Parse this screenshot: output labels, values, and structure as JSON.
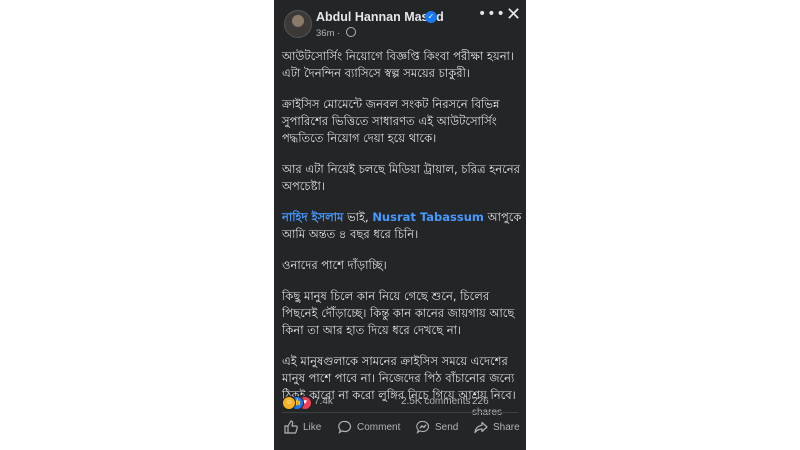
{
  "post": {
    "author": "Abdul Hannan Masud",
    "time": "36m",
    "paragraphs": [
      [
        "আউটসোর্সিং নিয়োগে বিজ্ঞপ্তি কিংবা পরীক্ষা হয়না।",
        "এটা দৈনন্দিন ব্যাসিসে স্বল্প সময়ের চাকুরী।"
      ],
      [
        "ক্রাইসিস মোমেন্টে জনবল সংকট নিরসনে বিভিন্ন",
        "সুপারিশের ভিত্তিতে সাধারণত এই আউটসোর্সিং",
        "পদ্ধতিতে নিয়োগ দেয়া হয়ে থাকে।"
      ],
      [
        "আর এটা নিয়েই চলছে মিডিয়া ট্রায়াল,  চরিত্র হননের",
        "অপচেষ্টা।"
      ],
      null,
      [
        "ওনাদের পাশে দাঁড়াচ্ছি।"
      ],
      [
        "কিছু  মানুষ চিলে কান নিয়ে গেছে শুনে, চিলের",
        "পিছনেই দৌঁড়াচ্ছে। কিন্তু কান কানের জায়গায় আছে",
        "কিনা তা আর হাত দিয়ে ধরে দেখছে না।"
      ],
      [
        "এই মানুষগুলাকে সামনের ক্রাইসিস সময়ে এদেশের",
        "মানুষ পাশে পাবে না। নিজেদের পিঠ বাঁচানোর জন্যে",
        "ঠিকই কারো না করো লুঙ্গির নিচে গিয়ে আশ্রয় নিবে।"
      ]
    ],
    "mention_para": {
      "mention1": "নাহিদ ইসলাম",
      "text1": " ভাই, ",
      "mention2": "Nusrat Tabassum",
      "text2": " আপুকে",
      "line2": "আমি অন্তত ৪ বছর ধরে চিনি।"
    }
  },
  "stats": {
    "reactions": "7.4k",
    "comments": "2.5K comments",
    "shares": "226 shares"
  },
  "actions": {
    "like": "Like",
    "comment": "Comment",
    "send": "Send",
    "share": "Share"
  },
  "colors": {
    "background": "#242526",
    "text": "#e4e6eb",
    "secondary": "#b0b3b8",
    "mention": "#4599ff",
    "verified": "#1877f2"
  },
  "icons": [
    "verified-icon",
    "globe-icon",
    "more-options-icon",
    "close-icon",
    "haha-reaction-icon",
    "like-reaction-icon",
    "love-reaction-icon",
    "like-icon",
    "comment-icon",
    "send-icon",
    "share-icon"
  ]
}
